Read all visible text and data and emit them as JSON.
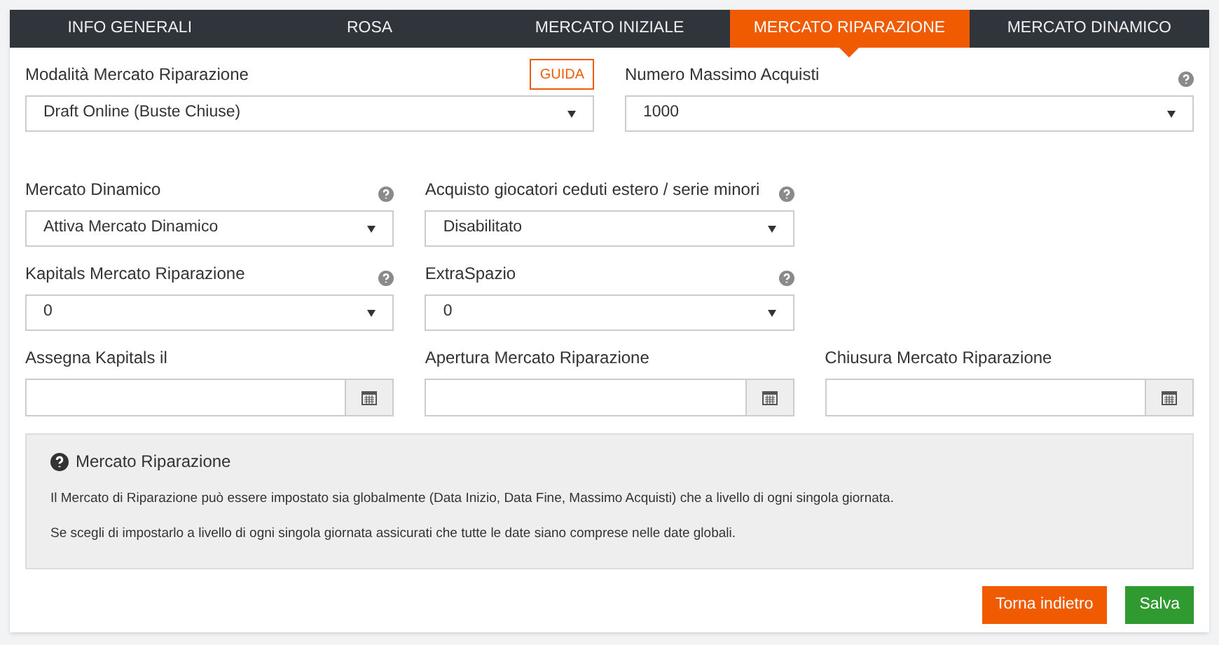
{
  "tabs": [
    {
      "label": "INFO GENERALI",
      "selected": false
    },
    {
      "label": "ROSA",
      "selected": false
    },
    {
      "label": "MERCATO INIZIALE",
      "selected": false
    },
    {
      "label": "MERCATO RIPARAZIONE",
      "selected": true
    },
    {
      "label": "MERCATO DINAMICO",
      "selected": false
    }
  ],
  "rows": [
    {
      "fields": [
        {
          "kind": "select",
          "label": "Modalità Mercato Riparazione",
          "help": false,
          "button": "GUIDA",
          "value": "Draft Online (Buste Chiuse)"
        },
        {
          "kind": "select",
          "label": "Numero Massimo Acquisti",
          "help": true,
          "value": "1000"
        }
      ]
    },
    {
      "fields": [
        {
          "kind": "select",
          "label": "Mercato Dinamico",
          "help": true,
          "value": "Attiva Mercato Dinamico"
        },
        {
          "kind": "select",
          "label": "Acquisto giocatori ceduti estero / serie minori",
          "help": true,
          "value": "Disabilitato"
        }
      ]
    },
    {
      "fields": [
        {
          "kind": "select",
          "label": "Kapitals Mercato Riparazione",
          "help": true,
          "value": "0"
        },
        {
          "kind": "select",
          "label": "ExtraSpazio",
          "help": true,
          "value": "0"
        }
      ]
    },
    {
      "fields": [
        {
          "kind": "date",
          "label": "Assegna Kapitals il",
          "help": false
        },
        {
          "kind": "date",
          "label": "Apertura Mercato Riparazione",
          "help": false
        },
        {
          "kind": "date",
          "label": "Chiusura Mercato Riparazione",
          "help": false
        }
      ]
    }
  ],
  "info": {
    "title": "Mercato Riparazione",
    "paragraphs": [
      "Il Mercato di Riparazione può essere impostato sia globalmente (Data Inizio, Data Fine, Massimo Acquisti) che a livello di ogni singola giornata.",
      "Se scegli di impostarlo a livello di ogni singola giornata assicurati che tutte le date siano comprese nelle date globali."
    ]
  },
  "buttons": [
    {
      "kind": "back",
      "label": "Torna indietro"
    },
    {
      "kind": "save",
      "label": "Salva"
    }
  ]
}
